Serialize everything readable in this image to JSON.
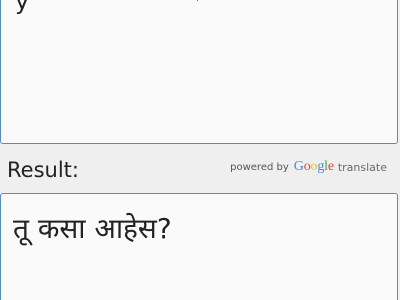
{
  "input": {
    "text": "y"
  },
  "result": {
    "label": "Result:",
    "text": "तू कसा आहेस?"
  },
  "attribution": {
    "powered_by": "powered by",
    "google_letters": [
      "G",
      "o",
      "o",
      "g",
      "l",
      "e"
    ],
    "translate": "translate"
  },
  "colors": {
    "border_accent": "#4a8ddf",
    "google_blue": "#4285f4",
    "google_red": "#ea4335",
    "google_yellow": "#fbbc05",
    "google_green": "#34a853"
  }
}
